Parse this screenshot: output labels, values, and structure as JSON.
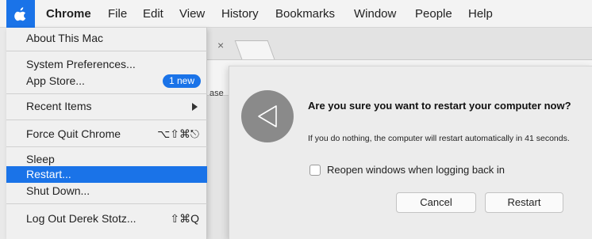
{
  "menubar": {
    "apple_icon": "apple-icon",
    "items": [
      "Chrome",
      "File",
      "Edit",
      "View",
      "History",
      "Bookmarks",
      "Window",
      "People",
      "Help"
    ]
  },
  "background_window": {
    "tab_close_glyph": "×",
    "partial_text": "ase"
  },
  "apple_menu": {
    "about": "About This Mac",
    "system_preferences": "System Preferences...",
    "app_store": "App Store...",
    "app_store_badge": "1 new",
    "recent_items": "Recent Items",
    "force_quit": "Force Quit Chrome",
    "force_quit_shortcut": "⌥⇧⌘⎋",
    "sleep": "Sleep",
    "restart": "Restart...",
    "shut_down": "Shut Down...",
    "log_out": "Log Out Derek Stotz...",
    "log_out_shortcut": "⇧⌘Q",
    "highlight_color": "#1a73e8"
  },
  "dialog": {
    "title": "Are you sure you want to restart your computer now?",
    "message": "If you do nothing, the computer will restart automatically in 41 seconds.",
    "checkbox_label": "Reopen windows when logging back in",
    "checkbox_checked": false,
    "cancel_label": "Cancel",
    "restart_label": "Restart",
    "icon": "restart-icon"
  }
}
